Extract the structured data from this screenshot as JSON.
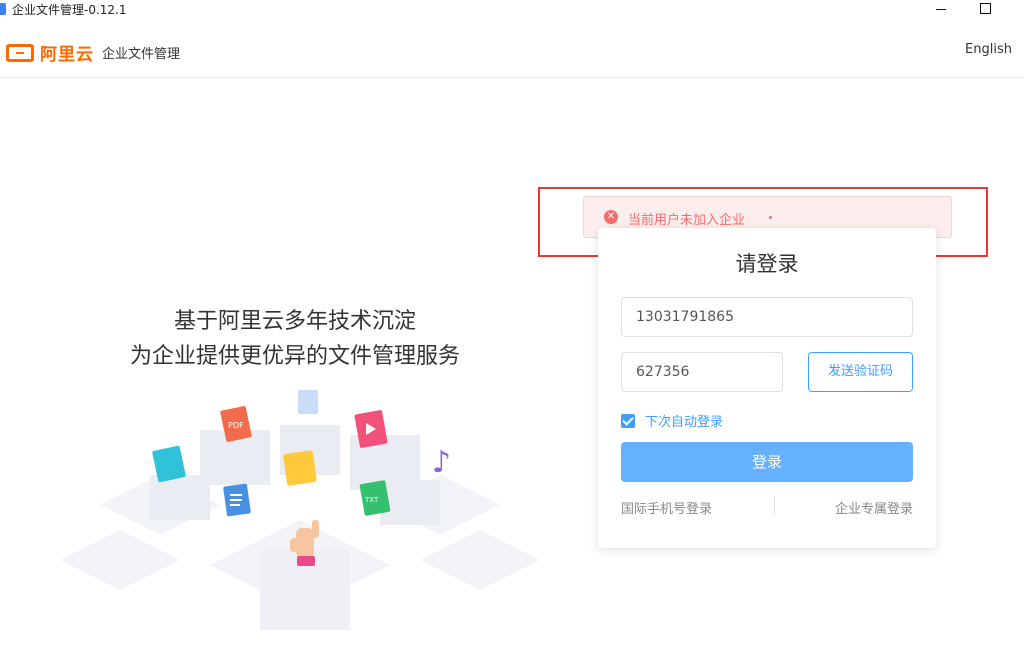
{
  "window": {
    "title": "企业文件管理-0.12.1"
  },
  "header": {
    "brand": "阿里云",
    "product": "企业文件管理",
    "language": "English"
  },
  "hero": {
    "line1": "基于阿里云多年技术沉淀",
    "line2": "为企业提供更优异的文件管理服务"
  },
  "alert": {
    "message": "当前用户未加入企业",
    "type": "error"
  },
  "login": {
    "title": "请登录",
    "phone_value": "13031791865",
    "code_value": "627356",
    "send_code_label": "发送验证码",
    "remember_label": "下次自动登录",
    "remember_checked": true,
    "submit_label": "登录",
    "intl_login_label": "国际手机号登录",
    "enterprise_login_label": "企业专属登录"
  },
  "illustration": {
    "labels": {
      "pdf": "PDF",
      "txt": "TXT"
    }
  },
  "colors": {
    "brand": "#ff6a00",
    "primary": "#409eff",
    "primary_light": "#66b1ff",
    "error": "#f56c6c"
  }
}
